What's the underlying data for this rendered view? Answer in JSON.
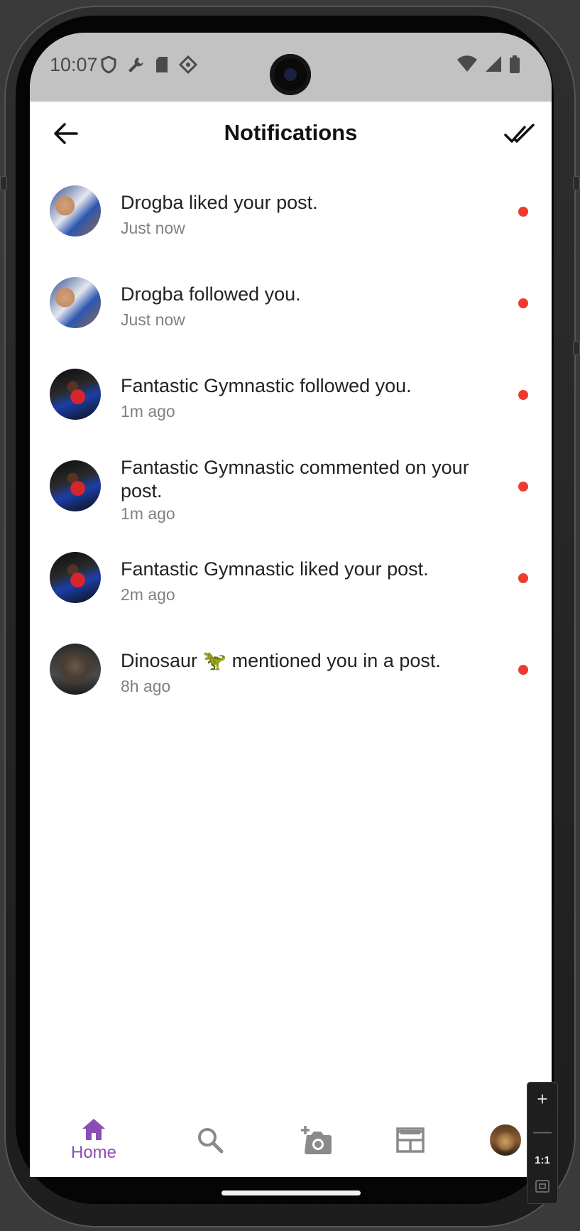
{
  "status_bar": {
    "time": "10:07",
    "left_icons": [
      "shield-icon",
      "wrench-icon",
      "sd-card-icon",
      "diamond-icon"
    ],
    "right_icons": [
      "wifi-icon",
      "signal-icon",
      "battery-icon"
    ]
  },
  "app_bar": {
    "title": "Notifications",
    "back_icon": "arrow-back-icon",
    "action_icon": "double-check-icon"
  },
  "notifications": [
    {
      "user": "Drogba",
      "message": "Drogba liked your post.",
      "time": "Just now",
      "unread": true
    },
    {
      "user": "Drogba",
      "message": "Drogba followed you.",
      "time": "Just now",
      "unread": true
    },
    {
      "user": "Fantastic Gymnastic",
      "message": "Fantastic Gymnastic followed you.",
      "time": "1m ago",
      "unread": true
    },
    {
      "user": "Fantastic Gymnastic",
      "message": "Fantastic Gymnastic commented on your post.",
      "time": "1m ago",
      "unread": true
    },
    {
      "user": "Fantastic Gymnastic",
      "message": "Fantastic Gymnastic liked your post.",
      "time": "2m ago",
      "unread": true
    },
    {
      "user": "Dinosaur 🦖",
      "message": "Dinosaur 🦖 mentioned you in a post.",
      "time": "8h ago",
      "unread": true
    }
  ],
  "bottom_nav": {
    "home_label": "Home",
    "items": [
      "home-icon",
      "search-icon",
      "add-photo-icon",
      "feed-icon",
      "profile-avatar"
    ]
  },
  "zoom_controls": {
    "zoom_in": "+",
    "zoom_out": "—",
    "ratio": "1:1"
  },
  "colors": {
    "accent": "#8c4cb5",
    "unread_dot": "#ee3b2e",
    "status_bar_bg": "#c2c2c2",
    "inactive_icon": "#8a8a8a"
  }
}
